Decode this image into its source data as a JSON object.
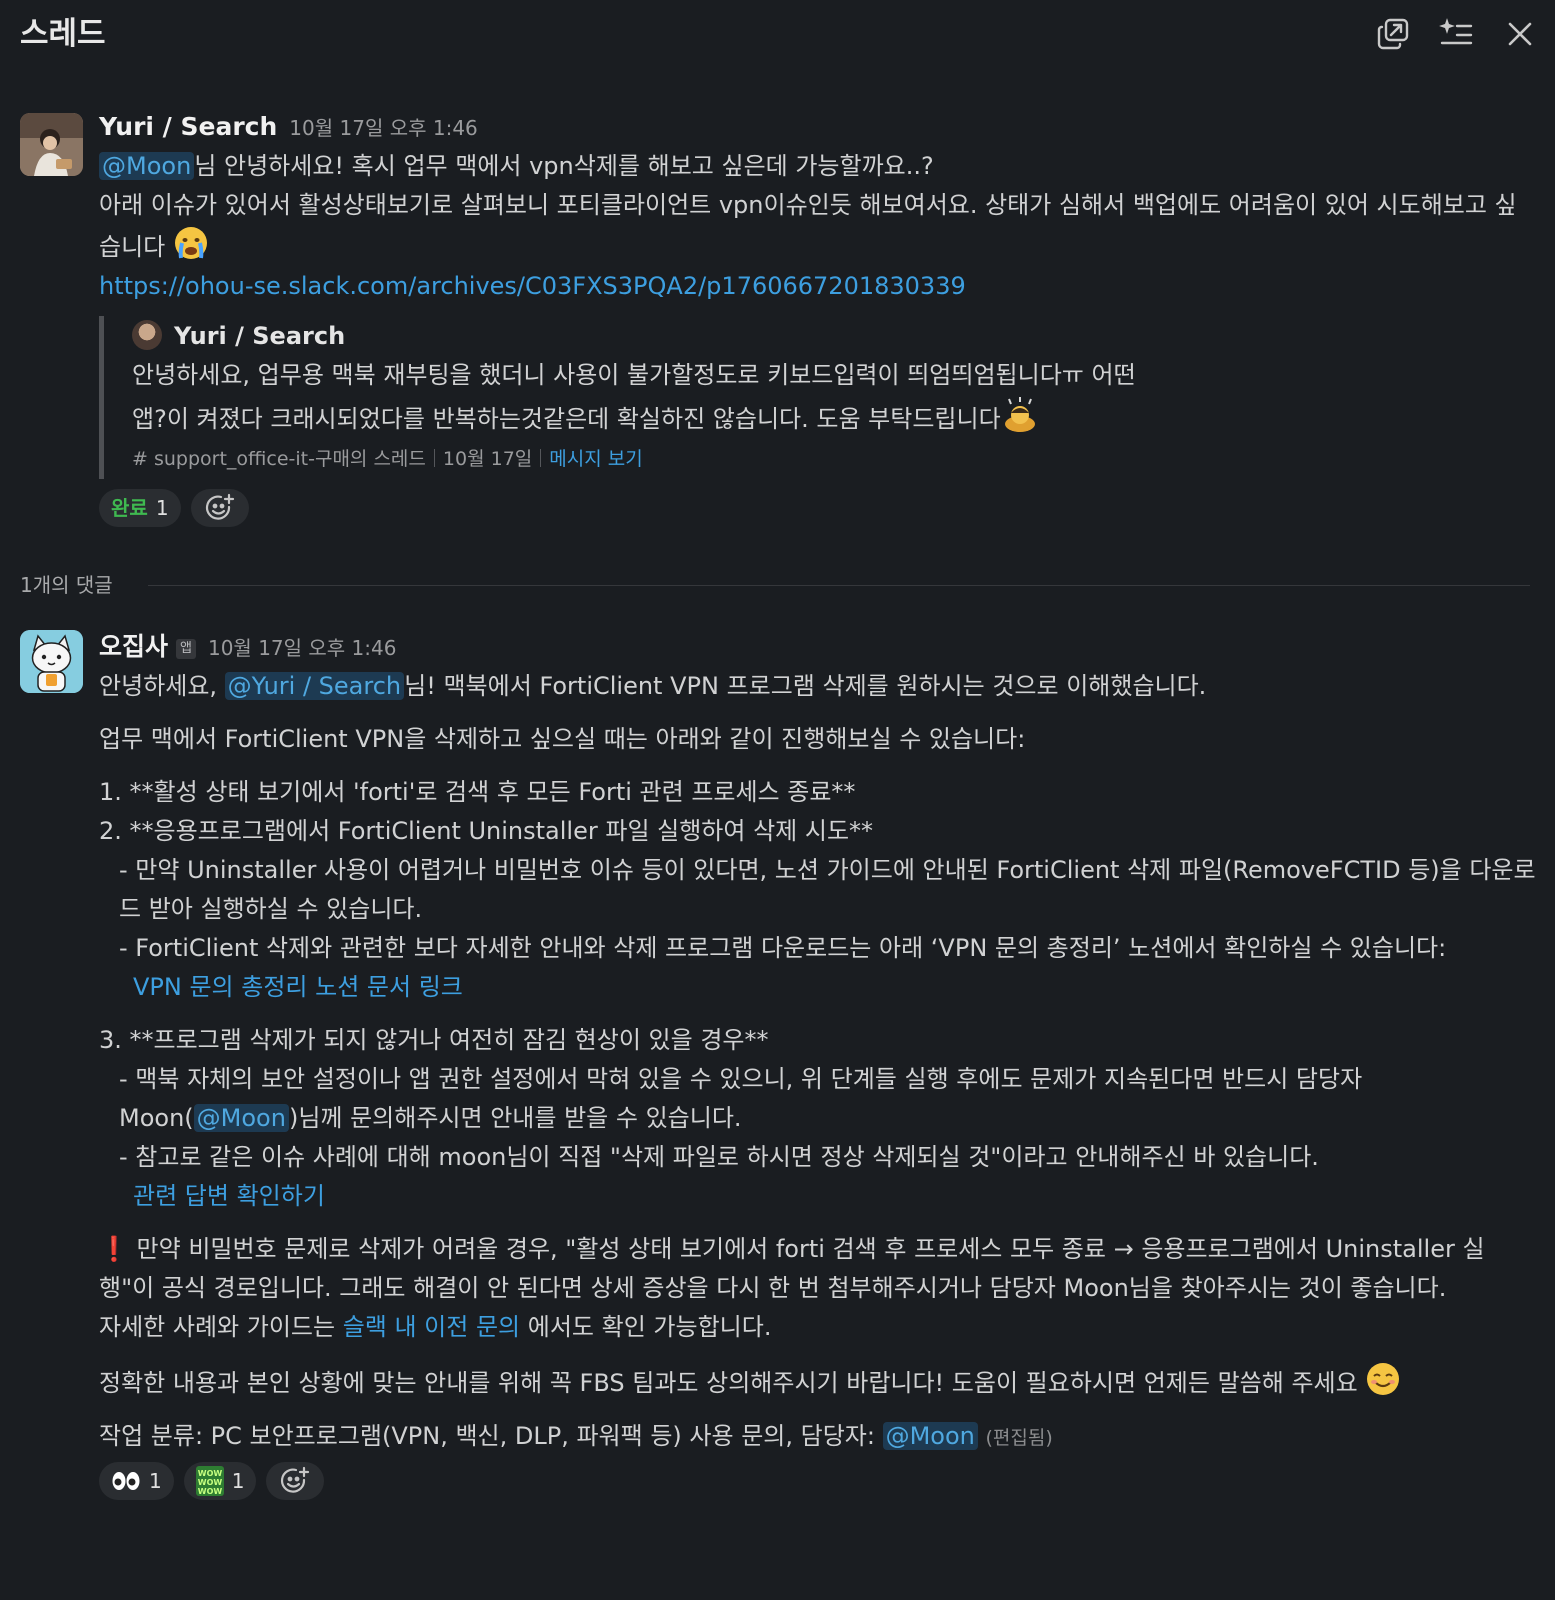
{
  "header": {
    "title": "스레드",
    "icons": [
      "popout-icon",
      "ai-summary-icon",
      "close-icon"
    ]
  },
  "parent": {
    "author": "Yuri / Search",
    "time": "10월 17일 오후 1:46",
    "mention": "@Moon",
    "line1_rest": "님 안녕하세요! 혹시 업무 맥에서 vpn삭제를 해보고 싶은데 가능할까요..?",
    "line2": "아래 이슈가 있어서 활성상태보기로 살펴보니 포티클라이언트 vpn이슈인듯 해보여서요. 상태가 심해서 백업에도 어려움이 있어 시도해보고 싶습니다",
    "link": "https://ohou-se.slack.com/archives/C03FXS3PQA2/p1760667201830339",
    "quote": {
      "author": "Yuri / Search",
      "text": "안녕하세요, 업무용 맥북 재부팅을 했더니 사용이 불가할정도로 키보드입력이 띄엄띄엄됩니다ㅠ 어떤 앱?이 켜졌다 크래시되었다를 반복하는것같은데 확실하진 않습니다. 도움 부탁드립니다",
      "channel": "# support_office-it-구매의 스레드",
      "date": "10월 17일",
      "view_link": "메시지 보기"
    },
    "reactions": [
      {
        "label": "완료",
        "count": "1",
        "color": "#3fb950"
      }
    ]
  },
  "reply_count": "1개의 댓글",
  "reply": {
    "author": "오집사",
    "badge": "앱",
    "time": "10월 17일 오후 1:46",
    "greet_a": "안녕하세요, ",
    "greet_mention": "@Yuri / Search",
    "greet_b": "님! 맥북에서 FortiClient VPN 프로그램 삭제를 원하시는 것으로 이해했습니다.",
    "intro": "업무 맥에서 FortiClient VPN을 삭제하고 싶으실 때는 아래와 같이 진행해보실 수 있습니다:",
    "step1": "1. **활성 상태 보기에서 'forti'로 검색 후 모든 Forti 관련 프로세스 종료**",
    "step2": "2. **응용프로그램에서 FortiClient Uninstaller 파일 실행하여 삭제 시도**",
    "step2_a": "- 만약 Uninstaller 사용이 어렵거나 비밀번호 이슈 등이 있다면, 노션 가이드에 안내된 FortiClient 삭제 파일(RemoveFCTID 등)을 다운로드 받아 실행하실 수 있습니다.",
    "step2_b": "- FortiClient 삭제와 관련한 보다 자세한 안내와 삭제 프로그램 다운로드는 아래 ‘VPN 문의 총정리’ 노션에서 확인하실 수 있습니다:",
    "step2_link": "VPN 문의 총정리 노션 문서 링크",
    "step3": "3. **프로그램 삭제가 되지 않거나 여전히 잠김 현상이 있을 경우**",
    "step3_a_1": "- 맥북 자체의 보안 설정이나 앱 권한 설정에서 막혀 있을 수 있으니, 위 단계들 실행 후에도 문제가 지속된다면 반드시 담당자 Moon(",
    "step3_a_mention": "@Moon",
    "step3_a_2": ")님께 문의해주시면 안내를 받을 수 있습니다.",
    "step3_b": "- 참고로 같은 이슈 사례에 대해 moon님이 직접 \"삭제 파일로 하시면 정상 삭제되실 것\"이라고 안내해주신 바 있습니다.",
    "step3_link": "관련 답변 확인하기",
    "warning_icon": "❗",
    "warning": "만약 비밀번호 문제로 삭제가 어려울 경우, \"활성 상태 보기에서 forti 검색 후 프로세스 모두 종료 → 응용프로그램에서 Uninstaller 실행\"이 공식 경로입니다. 그래도 해결이 안 된다면 상세 증상을 다시 한 번 첨부해주시거나 담당자 Moon님을 찾아주시는 것이 좋습니다.",
    "detail_a": "자세한 사례와 가이드는 ",
    "detail_link": "슬랙 내 이전 문의",
    "detail_b": " 에서도 확인 가능합니다.",
    "closing": "정확한 내용과 본인 상황에 맞는 안내를 위해 꼭 FBS 팀과도 상의해주시기 바랍니다! 도움이 필요하시면 언제든 말씀해 주세요",
    "category_a": "작업 분류: PC 보안프로그램(VPN, 백신, DLP, 파워팩 등) 사용 문의, 담당자: ",
    "category_mention": "@Moon",
    "edited": "(편집됨)",
    "reactions": [
      {
        "icon": "eyes-icon",
        "count": "1"
      },
      {
        "icon": "wow-icon",
        "count": "1"
      }
    ]
  }
}
